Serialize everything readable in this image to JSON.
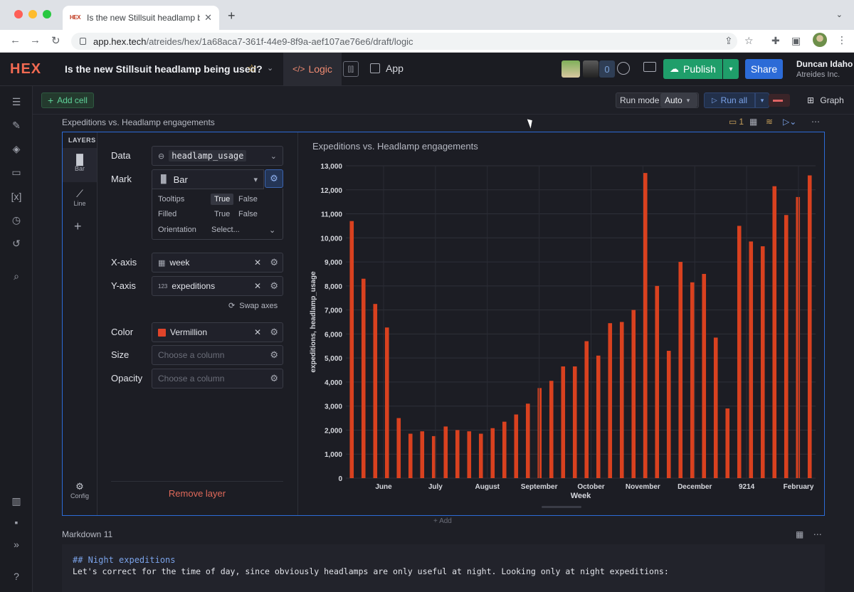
{
  "browser": {
    "tab_title": "Is the new Stillsuit headlamp b",
    "tab_favicon": "HEX",
    "url_host": "app.hex.tech",
    "url_path": "/atreides/hex/1a68aca7-361f-44e9-8f9a-aef107ae76e6/draft/logic"
  },
  "header": {
    "logo": "HEX",
    "title": "Is the new Stillsuit headlamp being used?",
    "logic_tab": "Logic",
    "app_tab": "App",
    "viewer_count": "0",
    "publish_label": "Publish",
    "share_label": "Share",
    "user_name": "Duncan Idaho",
    "user_org": "Atreides Inc."
  },
  "toolbar": {
    "add_cell": "Add cell",
    "run_mode_label": "Run mode",
    "run_mode_value": "Auto",
    "run_all": "Run all",
    "graph": "Graph"
  },
  "cell": {
    "title": "Expeditions vs. Headlamp engagements",
    "comment_count": "1",
    "layers": {
      "title": "LAYERS",
      "items": [
        "Bar",
        "Line"
      ],
      "config": "Config"
    },
    "config": {
      "data_label": "Data",
      "data_value": "headlamp_usage",
      "mark_label": "Mark",
      "mark_value": "Bar",
      "tooltips_label": "Tooltips",
      "filled_label": "Filled",
      "orientation_label": "Orientation",
      "true_label": "True",
      "false_label": "False",
      "orientation_value": "Select...",
      "xaxis_label": "X-axis",
      "xaxis_value": "week",
      "yaxis_label": "Y-axis",
      "yaxis_value": "expeditions",
      "yaxis_type": "123",
      "swap_axes": "Swap axes",
      "color_label": "Color",
      "color_value": "Vermillion",
      "size_label": "Size",
      "size_placeholder": "Choose a column",
      "opacity_label": "Opacity",
      "opacity_placeholder": "Choose a column",
      "remove_layer": "Remove layer"
    }
  },
  "chart_data": {
    "type": "bar",
    "title": "Expeditions vs. Headlamp engagements",
    "xlabel": "Week",
    "ylabel": "expeditions, headlamp_usage",
    "ylim": [
      0,
      13000
    ],
    "yticks": [
      "0",
      "1,000",
      "2,000",
      "3,000",
      "4,000",
      "5,000",
      "6,000",
      "7,000",
      "8,000",
      "9,000",
      "10,000",
      "11,000",
      "12,000",
      "13,000"
    ],
    "xtick_labels": [
      "June",
      "July",
      "August",
      "September",
      "October",
      "November",
      "December",
      "9214",
      "February"
    ],
    "bar_color": "#d9411f",
    "values": [
      10700,
      8300,
      7250,
      6270,
      2500,
      1850,
      1950,
      1750,
      2150,
      2000,
      1950,
      1850,
      2080,
      2350,
      2650,
      3100,
      3750,
      4050,
      4650,
      4650,
      5700,
      5100,
      6450,
      6500,
      7000,
      12700,
      8000,
      5300,
      9000,
      8150,
      8500,
      5850,
      2900,
      10500,
      9850,
      9650,
      12150,
      10950,
      11700,
      12600
    ]
  },
  "markdown": {
    "title": "Markdown 11",
    "line1": "## Night expeditions",
    "line2": "Let's correct for the time of day, since obviously headlamps are only useful at night. Looking only at night expeditions:",
    "add_label": "+ Add"
  }
}
